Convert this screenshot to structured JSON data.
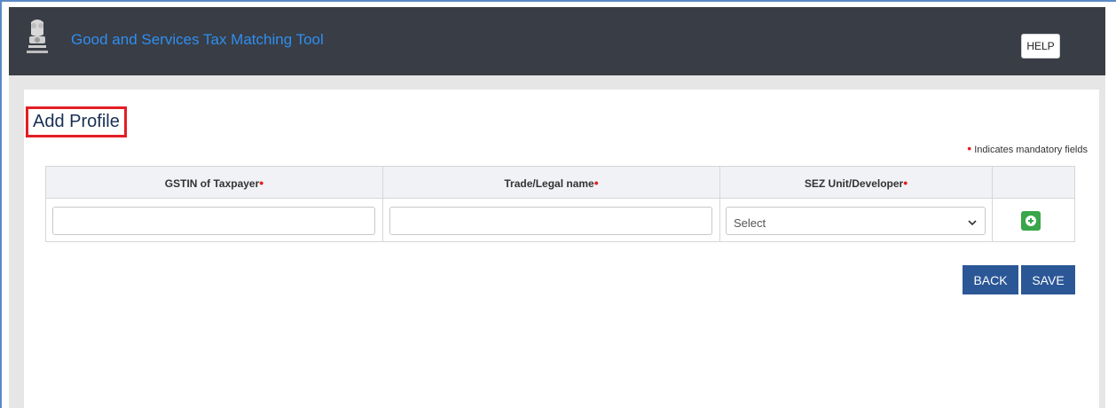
{
  "header": {
    "app_title": "Good and Services Tax Matching Tool",
    "help_label": "HELP"
  },
  "page": {
    "title": "Add Profile",
    "mandatory_note": "Indicates mandatory fields"
  },
  "table": {
    "columns": [
      "GSTIN of Taxpayer",
      "Trade/Legal name",
      "SEZ Unit/Developer"
    ],
    "row": {
      "gstin_value": "",
      "trade_name_value": "",
      "sez_selected": "Select"
    }
  },
  "actions": {
    "back_label": "BACK",
    "save_label": "SAVE"
  },
  "colors": {
    "header_bg": "#393d45",
    "title_blue": "#2f8ef0",
    "required_red": "#e31e24",
    "button_blue": "#2b5797",
    "add_green": "#3aa54a"
  },
  "icons": {
    "emblem": "national-emblem-icon",
    "add": "plus-circle-icon",
    "dropdown": "chevron-down-icon"
  }
}
